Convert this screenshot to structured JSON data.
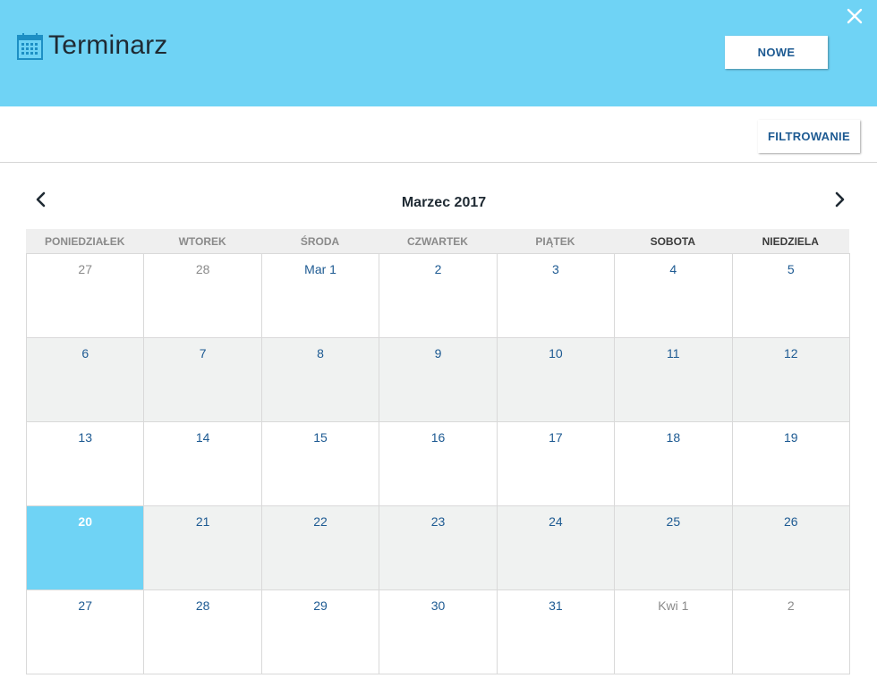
{
  "header": {
    "title": "Terminarz",
    "new_label": "NOWE",
    "accent_color": "#6fd3f5",
    "icon": "calendar-icon",
    "close_icon": "close-icon"
  },
  "toolbar": {
    "filter_label": "FILTROWANIE"
  },
  "calendar": {
    "month_label": "Marzec 2017",
    "prev_icon": "chevron-left-icon",
    "next_icon": "chevron-right-icon",
    "weekdays": [
      "PONIEDZIAŁEK",
      "WTOREK",
      "ŚRODA",
      "CZWARTEK",
      "PIĄTEK",
      "SOBOTA",
      "NIEDZIELA"
    ],
    "weeks": [
      {
        "days": [
          {
            "label": "27",
            "other_month": true
          },
          {
            "label": "28",
            "other_month": true
          },
          {
            "label": "Mar 1"
          },
          {
            "label": "2"
          },
          {
            "label": "3"
          },
          {
            "label": "4"
          },
          {
            "label": "5"
          }
        ]
      },
      {
        "days": [
          {
            "label": "6"
          },
          {
            "label": "7"
          },
          {
            "label": "8"
          },
          {
            "label": "9"
          },
          {
            "label": "10"
          },
          {
            "label": "11"
          },
          {
            "label": "12"
          }
        ]
      },
      {
        "days": [
          {
            "label": "13"
          },
          {
            "label": "14"
          },
          {
            "label": "15"
          },
          {
            "label": "16"
          },
          {
            "label": "17"
          },
          {
            "label": "18"
          },
          {
            "label": "19"
          }
        ]
      },
      {
        "days": [
          {
            "label": "20",
            "today": true
          },
          {
            "label": "21"
          },
          {
            "label": "22"
          },
          {
            "label": "23"
          },
          {
            "label": "24"
          },
          {
            "label": "25"
          },
          {
            "label": "26"
          }
        ]
      },
      {
        "days": [
          {
            "label": "27"
          },
          {
            "label": "28"
          },
          {
            "label": "29"
          },
          {
            "label": "30"
          },
          {
            "label": "31"
          },
          {
            "label": "Kwi 1",
            "other_month": true
          },
          {
            "label": "2",
            "other_month": true
          }
        ]
      }
    ]
  }
}
